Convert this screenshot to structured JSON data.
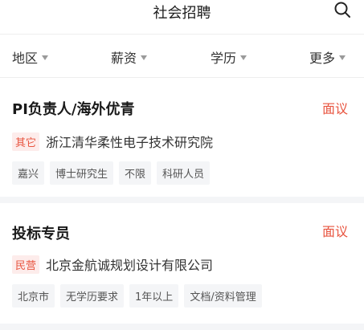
{
  "header": {
    "title": "社会招聘",
    "search_icon": "search-icon"
  },
  "filters": [
    {
      "label": "地区"
    },
    {
      "label": "薪资"
    },
    {
      "label": "学历"
    },
    {
      "label": "更多"
    }
  ],
  "jobs": [
    {
      "title": "PI负责人/海外优青",
      "salary": "面议",
      "company_type": "其它",
      "company": "浙江清华柔性电子技术研究院",
      "tags": [
        "嘉兴",
        "博士研究生",
        "不限",
        "科研人员"
      ]
    },
    {
      "title": "投标专员",
      "salary": "面议",
      "company_type": "民营",
      "company": "北京金航诚规划设计有限公司",
      "tags": [
        "北京市",
        "无学历要求",
        "1年以上",
        "文档/资料管理"
      ]
    }
  ],
  "colors": {
    "accent": "#e8543f",
    "tag_bg": "#f4f5f7",
    "badge_bg": "#fdeceb"
  }
}
